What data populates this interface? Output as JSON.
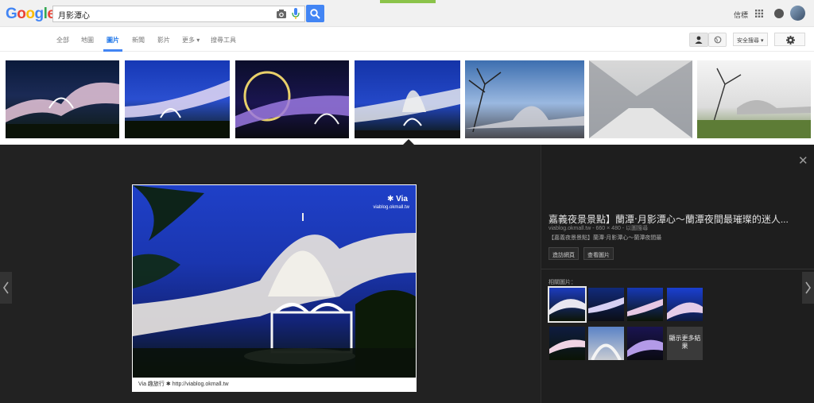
{
  "header": {
    "logo": "Google",
    "search_query": "月影潭心",
    "signin_label": "信標",
    "colors": {
      "search_button": "#4285f4",
      "loading_bar": "#8bc34a"
    }
  },
  "tabs": {
    "items": [
      "全部",
      "地圖",
      "圖片",
      "新聞",
      "影片",
      "更多 ▾",
      "搜尋工具"
    ],
    "active": "圖片"
  },
  "toolbar": {
    "safe_search_label": "安全搜尋 ▾"
  },
  "icons": [
    "camera-icon",
    "mic-icon",
    "search-icon",
    "apps-grid-icon",
    "bell-icon",
    "account-icon",
    "globe-icon",
    "gear-icon",
    "close-icon",
    "chevron-left-icon",
    "chevron-right-icon"
  ],
  "thumbnails": [
    "thumb-1",
    "thumb-2",
    "thumb-3",
    "thumb-4",
    "thumb-5",
    "thumb-6",
    "thumb-7"
  ],
  "preview": {
    "watermark_title": "✱ Via",
    "watermark_url": "viablog.okmall.tw",
    "caption": "Via 趣旅行 ✱ http://viablog.okmall.tw",
    "title": "嘉義夜景景點】蘭潭‧月影潭心～蘭潭夜間最璀璨的迷人...",
    "meta": "viablog.okmall.tw - 660 × 480 - 以圖搜尋",
    "description": "【嘉義夜景景點】蘭潭‧月影潭心～蘭潭夜間最",
    "visit_button": "造訪網頁",
    "view_button": "查看圖片",
    "related_label": "相關圖片：",
    "more_results": "顯示更多結果"
  }
}
